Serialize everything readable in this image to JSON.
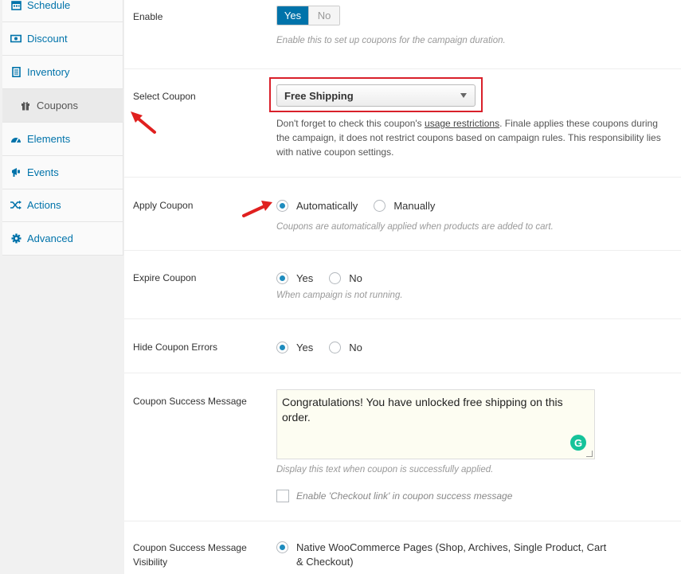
{
  "sidebar": {
    "items": [
      {
        "label": "Schedule",
        "icon": "calendar-icon"
      },
      {
        "label": "Discount",
        "icon": "money-icon"
      },
      {
        "label": "Inventory",
        "icon": "document-icon"
      },
      {
        "label": "Coupons",
        "icon": "gift-icon"
      },
      {
        "label": "Elements",
        "icon": "gauge-icon"
      },
      {
        "label": "Events",
        "icon": "megaphone-icon"
      },
      {
        "label": "Actions",
        "icon": "shuffle-icon"
      },
      {
        "label": "Advanced",
        "icon": "gear-icon"
      }
    ],
    "active": "Coupons",
    "link_color": "#0073aa"
  },
  "enable": {
    "label": "Enable",
    "yes": "Yes",
    "no": "No",
    "selected": "Yes",
    "description": "Enable this to set up coupons for the campaign duration."
  },
  "select_coupon": {
    "label": "Select Coupon",
    "value": "Free Shipping",
    "help_prefix": "Don't forget to check this coupon's ",
    "help_link": "usage restrictions",
    "help_suffix": ". Finale applies these coupons during the campaign, it does not restrict coupons based on campaign rules. This responsibility lies with native coupon settings."
  },
  "apply_coupon": {
    "label": "Apply Coupon",
    "options": [
      "Automatically",
      "Manually"
    ],
    "selected": "Automatically",
    "description": "Coupons are automatically applied when products are added to cart."
  },
  "expire_coupon": {
    "label": "Expire Coupon",
    "options": [
      "Yes",
      "No"
    ],
    "selected": "Yes",
    "description": "When campaign is not running."
  },
  "hide_errors": {
    "label": "Hide Coupon Errors",
    "options": [
      "Yes",
      "No"
    ],
    "selected": "Yes"
  },
  "success_message": {
    "label": "Coupon Success Message",
    "value": "Congratulations! You have unlocked free shipping on this order.",
    "description": "Display this text when coupon is successfully applied.",
    "checkout_link_label": "Enable 'Checkout link' in coupon success message",
    "checkout_link_checked": false
  },
  "visibility": {
    "label": "Coupon Success Message Visibility",
    "option": "Native WooCommerce Pages (Shop, Archives, Single Product, Cart & Checkout)",
    "selected": true
  },
  "colors": {
    "accent": "#0073aa",
    "highlight_border": "#d9202a",
    "arrow": "#e0201f"
  }
}
